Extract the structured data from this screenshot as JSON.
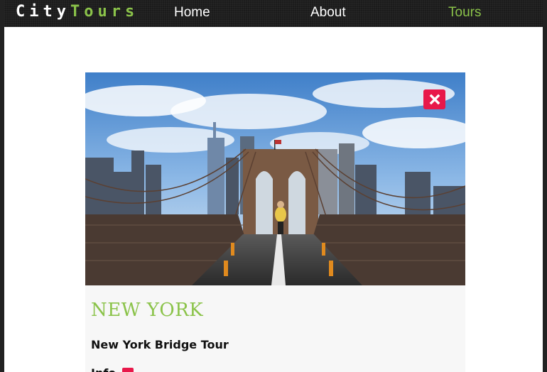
{
  "navbar": {
    "logo_part1": "City",
    "logo_part2": "Tours",
    "links": [
      {
        "label": "Home",
        "active": false
      },
      {
        "label": "About",
        "active": false
      },
      {
        "label": "Tours",
        "active": true
      }
    ],
    "accent_color": "#8bc34a"
  },
  "tour_card": {
    "image_icon": "brooklyn-bridge-photo",
    "close_icon": "close-icon",
    "close_color": "#e8184a",
    "city": "NEW YORK",
    "title": "New York Bridge Tour",
    "info_label": "Info"
  }
}
